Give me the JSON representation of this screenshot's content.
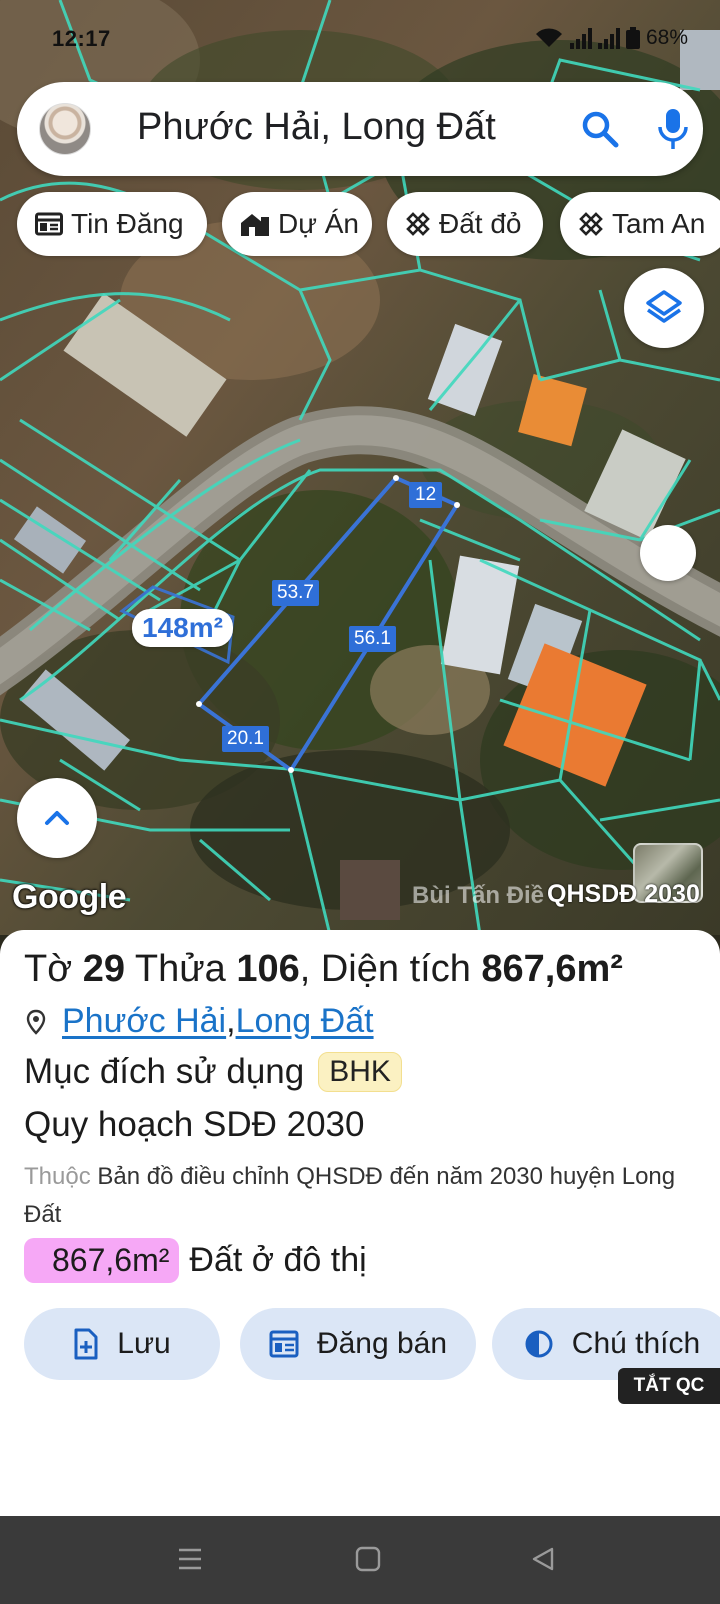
{
  "status_bar": {
    "time": "12:17",
    "battery": "68%"
  },
  "search": {
    "query": "Phước Hải, Long Đất"
  },
  "chips": [
    {
      "label": "Tin Đăng",
      "icon": "news-icon"
    },
    {
      "label": "Dự Án",
      "icon": "building-icon"
    },
    {
      "label": "Đất đỏ",
      "icon": "ruler-icon"
    },
    {
      "label": "Tam An",
      "icon": "ruler-icon"
    }
  ],
  "parcel": {
    "area_label": "148m²",
    "edges": [
      "53.7",
      "12",
      "56.1",
      "20.1"
    ]
  },
  "map": {
    "attribution": "Google",
    "watermark": "Bùi Tấn Điề",
    "plan_tag": "QHSDĐ 2030"
  },
  "info": {
    "sheet_prefix": "Tờ ",
    "sheet_no": "29",
    "plot_prefix": " Thửa ",
    "plot_no": "106",
    "area_prefix": ", Diện tích ",
    "area_value": "867,6m²",
    "location_ward": "Phước Hải",
    "location_sep": ", ",
    "location_district": "Long Đất",
    "purpose_label": "Mục đích sử dụng",
    "purpose_code": "BHK",
    "plan_title": "Quy hoạch SDĐ 2030",
    "plan_desc_prefix": "Thuộc",
    "plan_desc": " Bản đồ điều chỉnh QHSDĐ đến năm 2030 huyện Long Đất",
    "plan_area": "867,6m²",
    "plan_area_type": "Đất ở đô thị"
  },
  "actions": {
    "save": "Lưu",
    "post": "Đăng bán",
    "legend": "Chú thích"
  },
  "ad_tag": "TẮT QC",
  "colors": {
    "parcel_outline": "#3a73d6",
    "parcel_label_bg": "#2f6fd8",
    "cadastral_lines": "#40d9be",
    "area_highlight": "#f6a8f6",
    "action_bg": "#dbe6f6",
    "link": "#1a73c8"
  }
}
